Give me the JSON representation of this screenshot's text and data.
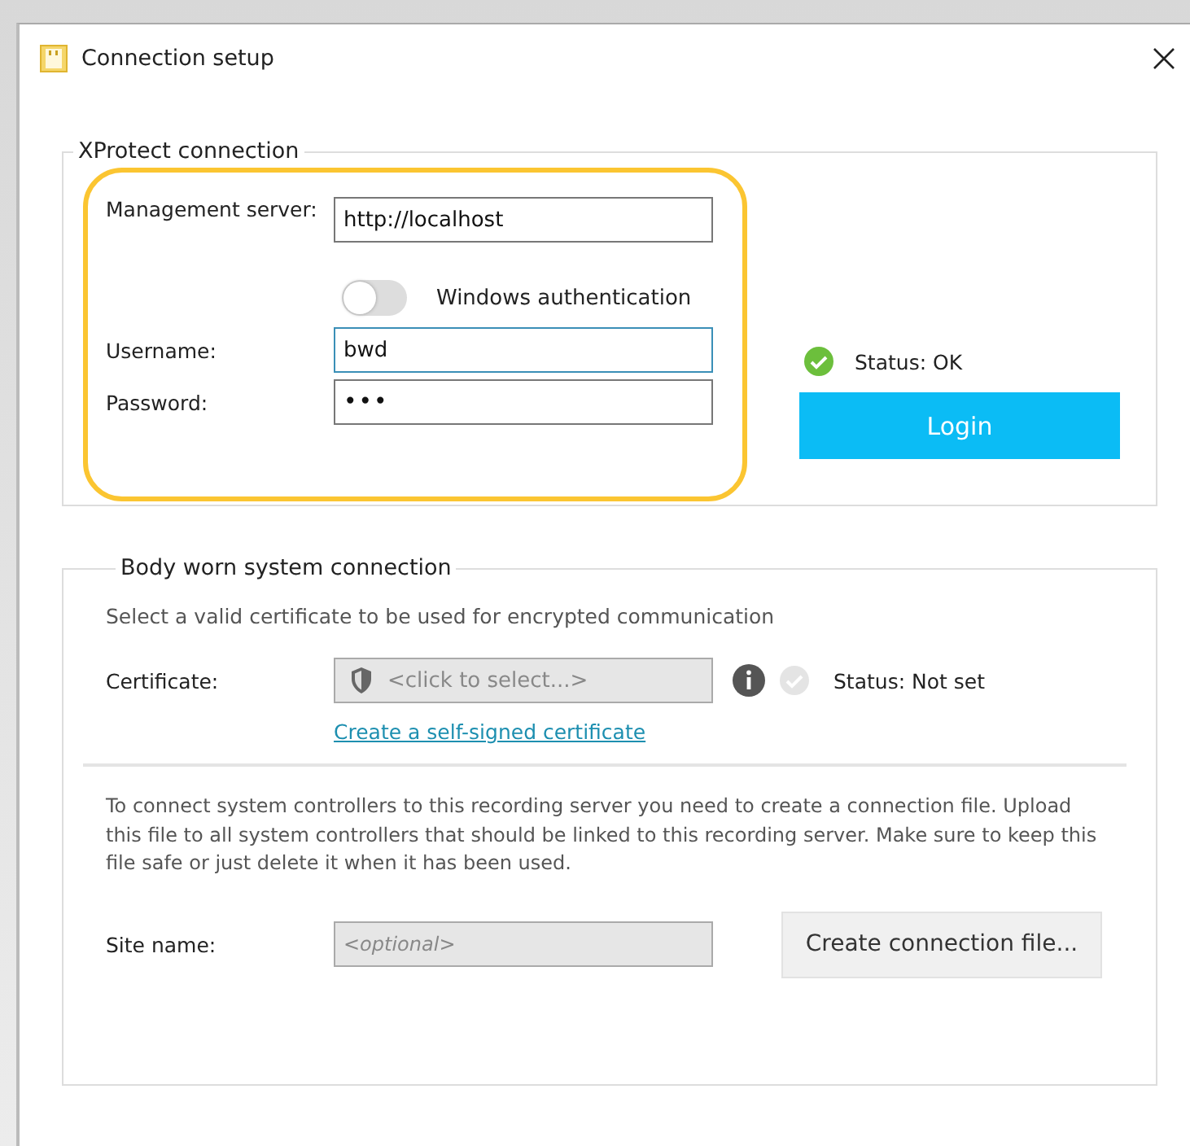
{
  "window": {
    "title": "Connection setup"
  },
  "xprotect": {
    "legend": "XProtect connection",
    "server": {
      "label": "Management server:",
      "value": "http://localhost"
    },
    "windows_auth": {
      "label": "Windows authentication",
      "on": false
    },
    "username": {
      "label": "Username:",
      "value": "bwd",
      "focused": true
    },
    "password": {
      "label": "Password:",
      "value": "•••"
    },
    "status": {
      "text": "Status: OK",
      "ok": true
    },
    "login_button": "Login"
  },
  "body_worn": {
    "legend": "Body worn system connection",
    "hint": "Select a valid certificate to be used for encrypted communication",
    "certificate": {
      "label": "Certificate:",
      "placeholder": "<click to select...>"
    },
    "status": {
      "text": "Status: Not set",
      "ok": false
    },
    "link": "Create a self-signed certificate",
    "description": "To connect system controllers to this recording server you need to create a connection file. Upload this file to all system controllers that should be linked to this recording server. Make sure to keep this file safe or just delete it when it has been used.",
    "site": {
      "label": "Site name:",
      "placeholder": "<optional>"
    },
    "create_button": "Create connection file..."
  }
}
